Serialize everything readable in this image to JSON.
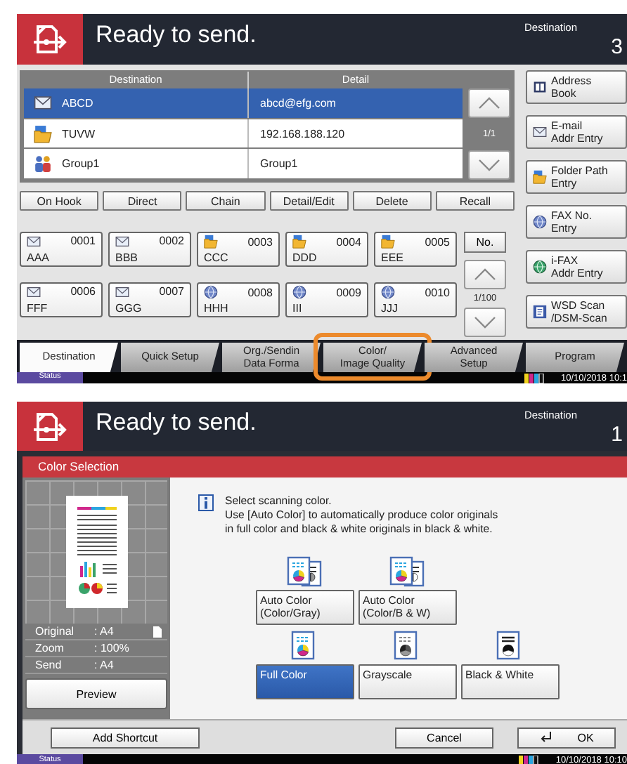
{
  "send_screen": {
    "header": {
      "title": "Ready to send.",
      "destination_label": "Destination",
      "destination_count": "3"
    },
    "destinations": {
      "columns": [
        "Destination",
        "Detail"
      ],
      "rows": [
        {
          "kind": "email",
          "name": "ABCD",
          "detail": "abcd@efg.com",
          "selected": true
        },
        {
          "kind": "folder",
          "name": "TUVW",
          "detail": "192.168.188.120",
          "selected": false
        },
        {
          "kind": "group",
          "name": "Group1",
          "detail": "Group1",
          "selected": false
        }
      ],
      "page": "1/1"
    },
    "actions": [
      "On Hook",
      "Direct",
      "Chain",
      "Detail/Edit",
      "Delete",
      "Recall"
    ],
    "one_touch_keys": [
      {
        "kind": "email",
        "number": "0001",
        "name": "AAA"
      },
      {
        "kind": "email",
        "number": "0002",
        "name": "BBB"
      },
      {
        "kind": "folder",
        "number": "0003",
        "name": "CCC"
      },
      {
        "kind": "folder",
        "number": "0004",
        "name": "DDD"
      },
      {
        "kind": "folder",
        "number": "0005",
        "name": "EEE"
      },
      {
        "kind": "email",
        "number": "0006",
        "name": "FFF"
      },
      {
        "kind": "email",
        "number": "0007",
        "name": "GGG"
      },
      {
        "kind": "fax",
        "number": "0008",
        "name": "HHH"
      },
      {
        "kind": "fax",
        "number": "0009",
        "name": "III"
      },
      {
        "kind": "fax",
        "number": "0010",
        "name": "JJJ"
      }
    ],
    "key_nav": {
      "button": "No.",
      "page": "1/100"
    },
    "entry_buttons": [
      {
        "kind": "book",
        "lines": [
          "Address",
          "Book"
        ]
      },
      {
        "kind": "email",
        "lines": [
          "E-mail",
          "Addr Entry"
        ]
      },
      {
        "kind": "folder",
        "lines": [
          "Folder Path",
          "Entry"
        ]
      },
      {
        "kind": "fax",
        "lines": [
          "FAX No.",
          "Entry"
        ]
      },
      {
        "kind": "ifax",
        "lines": [
          "i-FAX",
          "Addr Entry"
        ]
      },
      {
        "kind": "wsd",
        "lines": [
          "WSD Scan",
          "/DSM-Scan"
        ]
      }
    ],
    "tabs": [
      {
        "lines": [
          "Destination"
        ],
        "selected": true,
        "highlighted": false
      },
      {
        "lines": [
          "Quick Setup"
        ],
        "selected": false,
        "highlighted": false
      },
      {
        "lines": [
          "Org./Sendin",
          "Data Forma"
        ],
        "selected": false,
        "highlighted": false
      },
      {
        "lines": [
          "Color/",
          "Image Quality"
        ],
        "selected": false,
        "highlighted": true
      },
      {
        "lines": [
          "Advanced",
          "Setup"
        ],
        "selected": false,
        "highlighted": false
      },
      {
        "lines": [
          "Program"
        ],
        "selected": false,
        "highlighted": false
      }
    ],
    "status_bar": {
      "button": "Status",
      "datetime": "10/10/2018 10:1"
    }
  },
  "color_screen": {
    "header": {
      "title": "Ready to send.",
      "destination_label": "Destination",
      "destination_count": "1"
    },
    "panel_title": "Color Selection",
    "preview": {
      "rows": [
        {
          "label": "Original",
          "value": ": A4",
          "orientation": true
        },
        {
          "label": "Zoom",
          "value": ": 100%",
          "orientation": false
        },
        {
          "label": "Send",
          "value": ": A4",
          "orientation": false
        }
      ],
      "button": "Preview"
    },
    "message": [
      "Select scanning color.",
      "Use [Auto Color] to automatically produce color originals",
      "in full color and black & white originals in black & white."
    ],
    "option_rows": [
      [
        {
          "kind": "auto_gray",
          "lines": [
            "Auto Color",
            "(Color/Gray)"
          ],
          "selected": false
        },
        {
          "kind": "auto_bw",
          "lines": [
            "Auto Color",
            "(Color/B & W)"
          ],
          "selected": false
        }
      ],
      [
        {
          "kind": "full",
          "lines": [
            "Full Color"
          ],
          "selected": true
        },
        {
          "kind": "gray",
          "lines": [
            "Grayscale"
          ],
          "selected": false
        },
        {
          "kind": "bw",
          "lines": [
            "Black & White"
          ],
          "selected": false
        }
      ]
    ],
    "footer": {
      "shortcut": "Add Shortcut",
      "cancel": "Cancel",
      "ok": "OK"
    },
    "status_bar": {
      "button": "Status",
      "datetime": "10/10/2018 10:10"
    }
  }
}
